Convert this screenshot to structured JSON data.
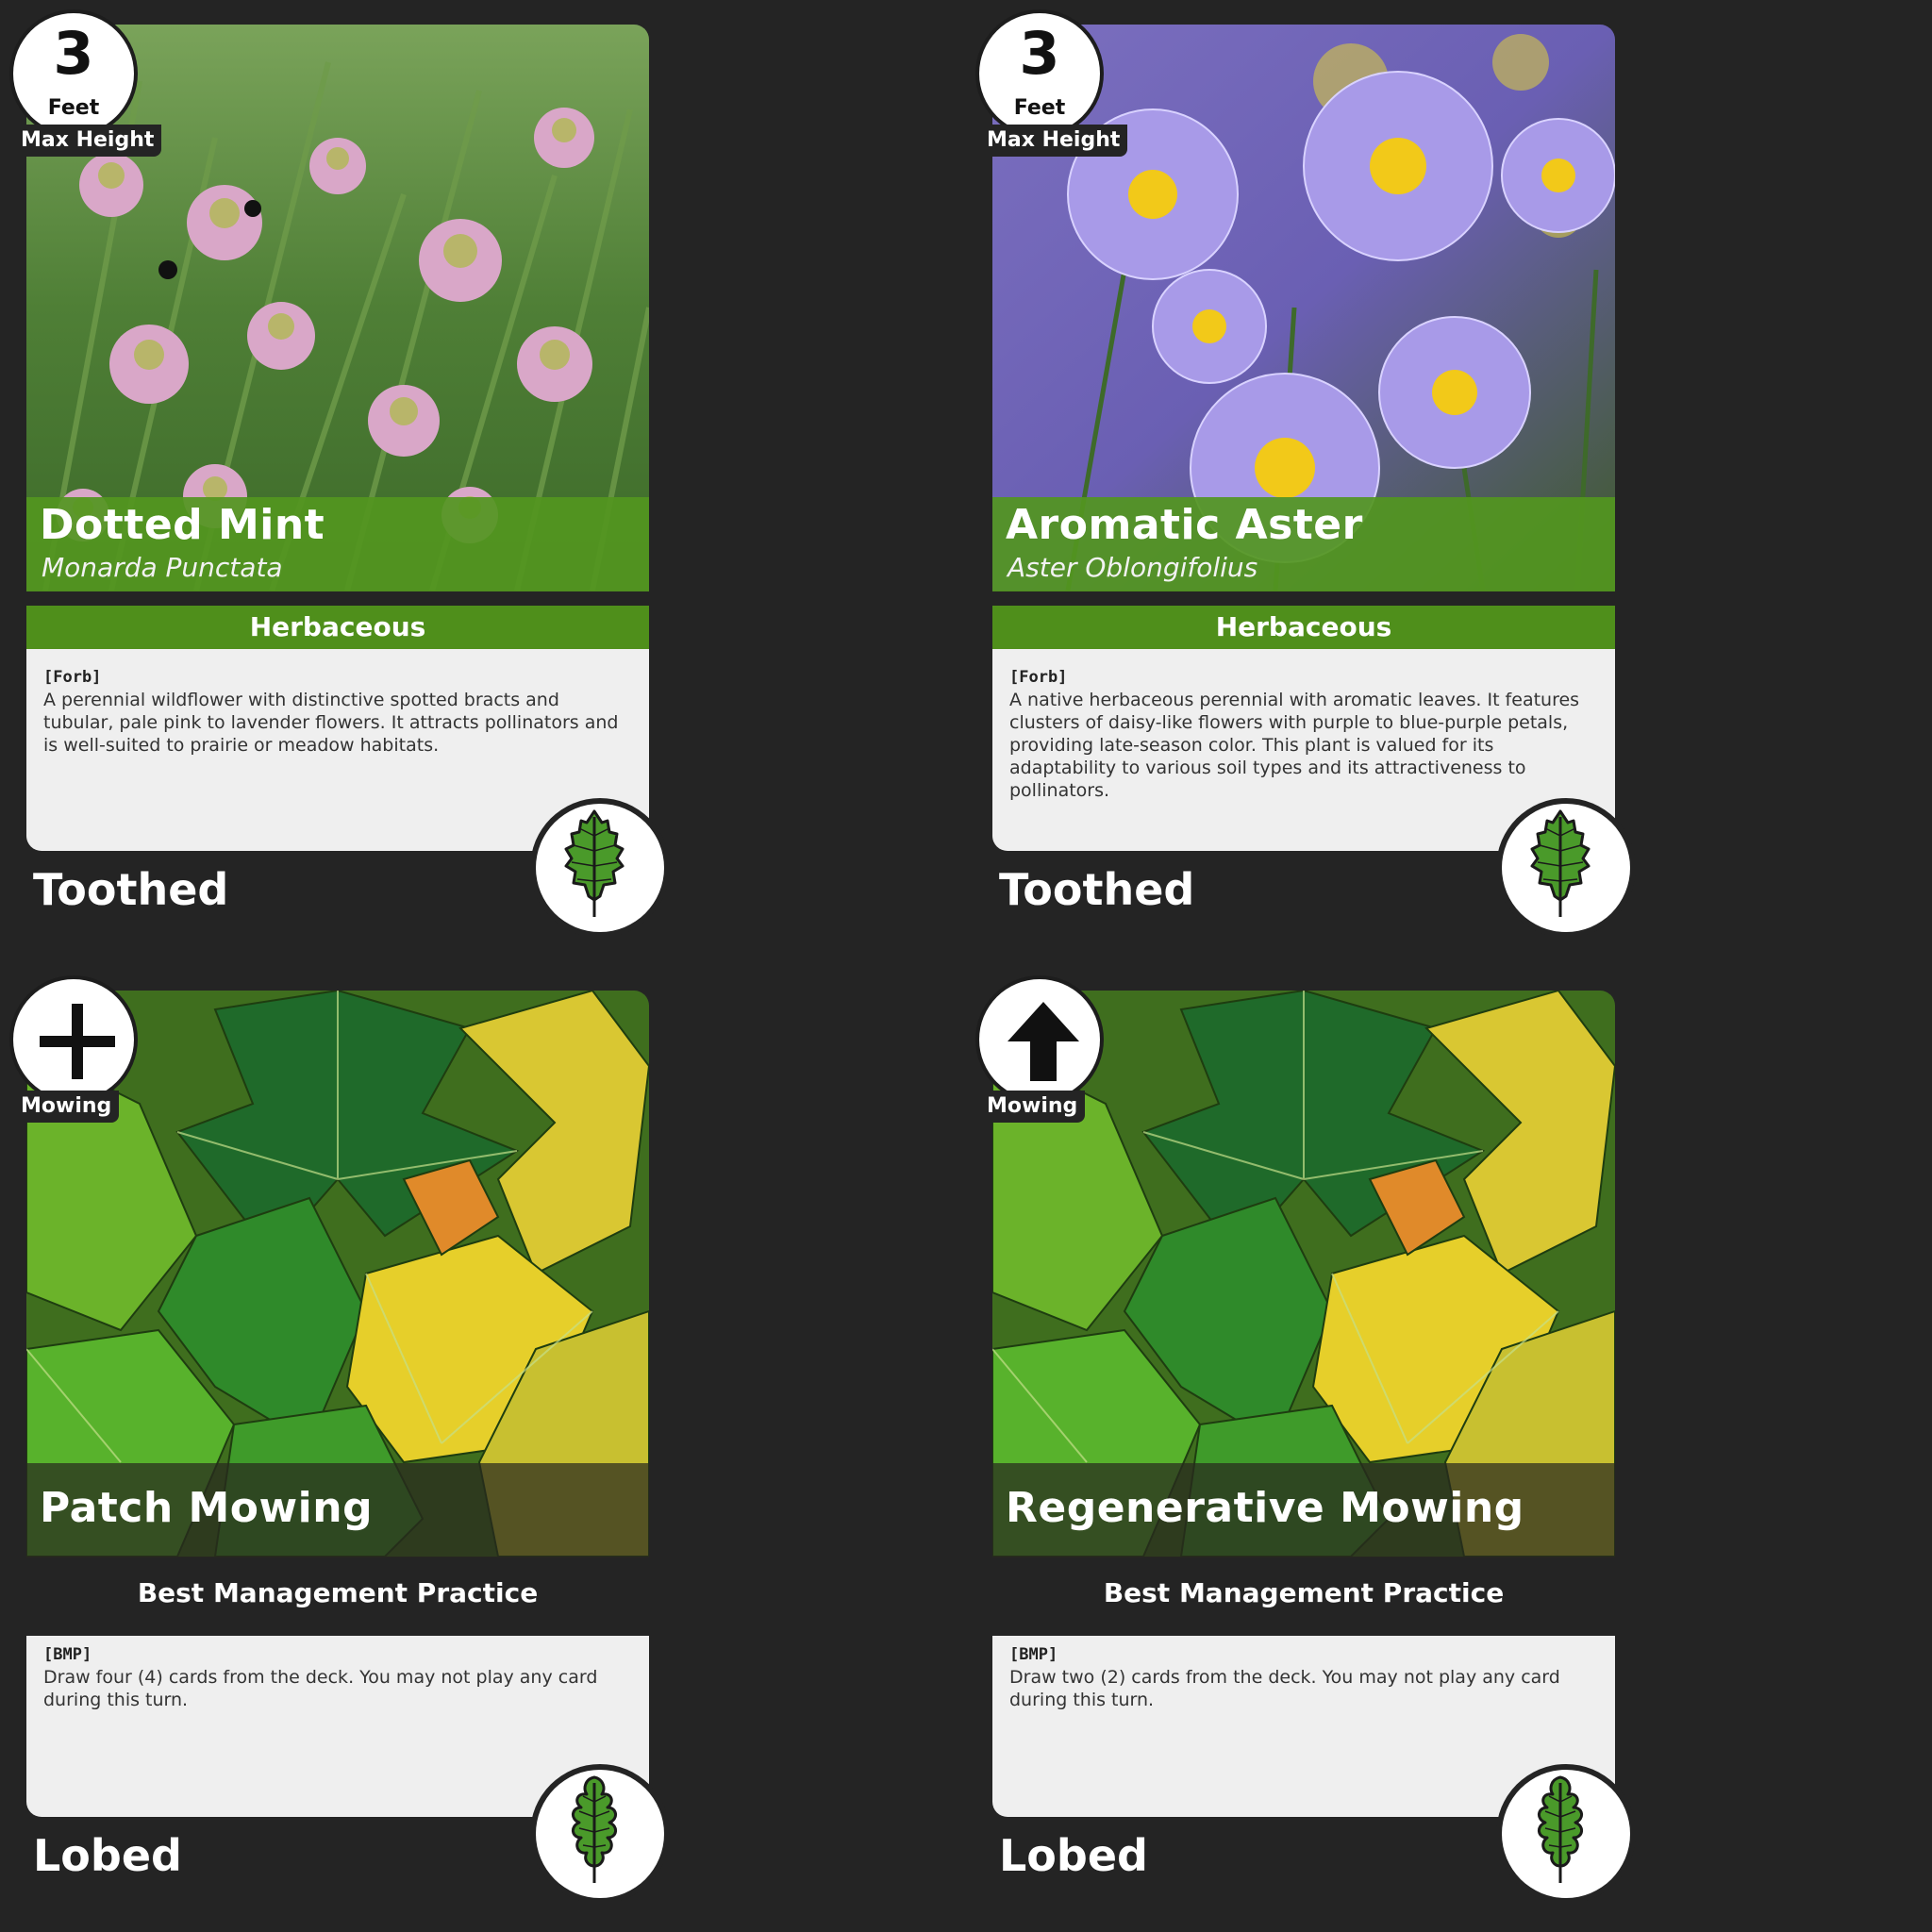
{
  "cards": [
    {
      "title": "Dotted Mint",
      "subtitle": "Monarda Punctata",
      "type": "Herbaceous",
      "tag": "[Forb]",
      "description": "A perennial wildflower with distinctive spotted bracts and tubular, pale pink to lavender flowers. It attracts pollinators and is well-suited to prairie or meadow habitats.",
      "badge_value": "3",
      "badge_unit": "Feet",
      "badge_label": "Max Height",
      "leaf_type": "Toothed",
      "leaf_icon": "toothed-leaf-icon",
      "art": "pink-wildflowers-photo"
    },
    {
      "title": "Aromatic Aster",
      "subtitle": "Aster Oblongifolius",
      "type": "Herbaceous",
      "tag": "[Forb]",
      "description": "A native herbaceous perennial with aromatic leaves. It features clusters of daisy-like flowers with purple to blue-purple petals, providing late-season color. This plant is valued for its adaptability to various soil types and its attractiveness to pollinators.",
      "badge_value": "3",
      "badge_unit": "Feet",
      "badge_label": "Max Height",
      "leaf_type": "Toothed",
      "leaf_icon": "toothed-leaf-icon",
      "art": "purple-aster-photo"
    },
    {
      "title": "Patch Mowing",
      "type": "Best Management Practice",
      "tag": "[BMP]",
      "description": "Draw four (4) cards from the deck. You may not play any card during this turn.",
      "badge_icon": "plus-icon",
      "badge_label": "Mowing",
      "leaf_type": "Lobed",
      "leaf_icon": "lobed-leaf-icon",
      "art": "maple-leaves-illustration"
    },
    {
      "title": "Regenerative Mowing",
      "type": "Best Management Practice",
      "tag": "[BMP]",
      "description": "Draw two (2) cards from the deck. You may not play any card during this turn.",
      "badge_icon": "up-arrow-icon",
      "badge_label": "Mowing",
      "leaf_type": "Lobed",
      "leaf_icon": "lobed-leaf-icon",
      "art": "maple-leaves-illustration"
    }
  ],
  "colors": {
    "background": "#242424",
    "plant_band": "#4f8f1b",
    "text_box": "#efefef"
  }
}
